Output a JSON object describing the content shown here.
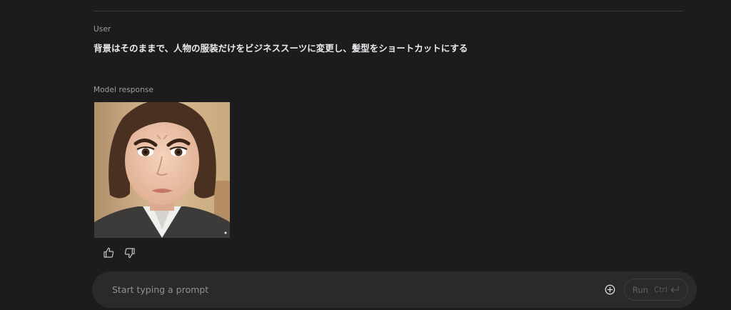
{
  "conversation": {
    "user_label": "User",
    "user_message": "背景はそのままで、人物の服装だけをビジネススーツに変更し、髪型をショートカットにする",
    "model_label": "Model response"
  },
  "feedback": {
    "thumb_up_icon": "thumb-up-icon",
    "thumb_down_icon": "thumb-down-icon"
  },
  "prompt_bar": {
    "placeholder": "Start typing a prompt",
    "add_icon": "add-circle-icon",
    "run_label": "Run",
    "run_shortcut": "Ctrl",
    "enter_icon": "enter-key-icon"
  },
  "colors": {
    "background": "#1c1c1c",
    "prompt_bar": "#2a2a2b",
    "text_primary": "#e8eaed",
    "text_secondary": "#9aa0a6"
  }
}
